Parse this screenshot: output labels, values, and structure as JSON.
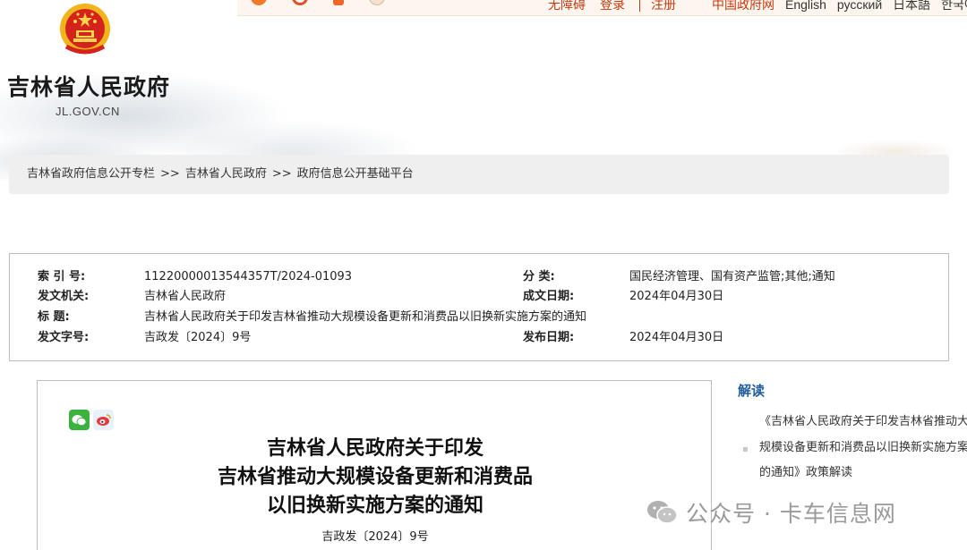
{
  "header": {
    "site_title": "吉林省人民政府",
    "domain": "JL.GOV.CN",
    "top_links": [
      "无障碍",
      "登录",
      "注册"
    ],
    "languages": [
      "中国政府网",
      "English",
      "русский",
      "日本語",
      "한국어"
    ],
    "icons": [
      "orange-circle-icon",
      "red-circle-icon",
      "orange-app-icon",
      "mascot-icon"
    ]
  },
  "breadcrumb": {
    "items": [
      "吉林省政府信息公开专栏",
      ">>",
      "吉林省人民政府",
      ">>",
      "政府信息公开基础平台"
    ]
  },
  "meta": {
    "index_label": "索 引 号:",
    "index_value": "11220000013544357T/2024-01093",
    "category_label": "分   类:",
    "category_value": "国民经济管理、国有资产监管;其他;通知",
    "issuer_label": "发文机关:",
    "issuer_value": "吉林省人民政府",
    "created_label": "成文日期:",
    "created_value": "2024年04月30日",
    "title_label": "标     题:",
    "title_value": "吉林省人民政府关于印发吉林省推动大规模设备更新和消费品以旧换新实施方案的通知",
    "docno_label": "发文字号:",
    "docno_value": "吉政发〔2024〕9号",
    "published_label": "发布日期:",
    "published_value": "2024年04月30日"
  },
  "document": {
    "title_lines": [
      "吉林省人民政府关于印发",
      "吉林省推动大规模设备更新和消费品",
      "以旧换新实施方案的通知"
    ],
    "number": "吉政发〔2024〕9号",
    "share_icons": [
      "wechat-icon",
      "weibo-icon"
    ]
  },
  "sidebar": {
    "title": "解读",
    "item": "《吉林省人民政府关于印发吉林省推动大规模设备更新和消费品以旧换新实施方案的通知》政策解读"
  },
  "watermark": {
    "text": "公众号 · 卡车信息网"
  },
  "colors": {
    "accent_red": "#c9380f",
    "link_blue": "#1f5c9e",
    "breadcrumb_bg": "#efefef",
    "border": "#bdbdbd"
  }
}
